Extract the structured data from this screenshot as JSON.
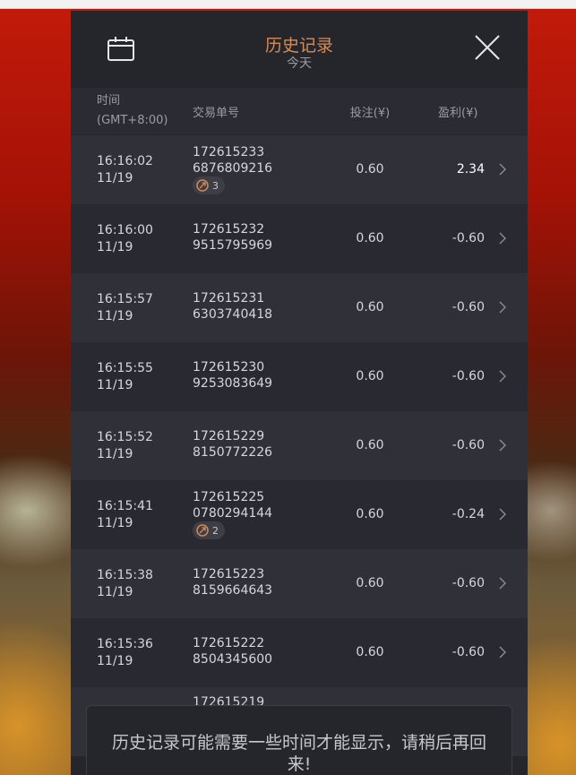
{
  "header": {
    "title": "历史记录",
    "subtitle": "今天"
  },
  "columns": {
    "time_line1": "时间",
    "time_line2": "(GMT+8:00)",
    "order": "交易单号",
    "bet": "投注(¥)",
    "profit": "盈利(¥)"
  },
  "rows": [
    {
      "time": "16:16:02",
      "date": "11/19",
      "order1": "172615233",
      "order2": "6876809216",
      "bet": "0.60",
      "profit": "2.34",
      "badge": "3"
    },
    {
      "time": "16:16:00",
      "date": "11/19",
      "order1": "172615232",
      "order2": "9515795969",
      "bet": "0.60",
      "profit": "-0.60"
    },
    {
      "time": "16:15:57",
      "date": "11/19",
      "order1": "172615231",
      "order2": "6303740418",
      "bet": "0.60",
      "profit": "-0.60"
    },
    {
      "time": "16:15:55",
      "date": "11/19",
      "order1": "172615230",
      "order2": "9253083649",
      "bet": "0.60",
      "profit": "-0.60"
    },
    {
      "time": "16:15:52",
      "date": "11/19",
      "order1": "172615229",
      "order2": "8150772226",
      "bet": "0.60",
      "profit": "-0.60"
    },
    {
      "time": "16:15:41",
      "date": "11/19",
      "order1": "172615225",
      "order2": "0780294144",
      "bet": "0.60",
      "profit": "-0.24",
      "badge": "2"
    },
    {
      "time": "16:15:38",
      "date": "11/19",
      "order1": "172615223",
      "order2": "8159664643",
      "bet": "0.60",
      "profit": "-0.60"
    },
    {
      "time": "16:15:36",
      "date": "11/19",
      "order1": "172615222",
      "order2": "8504345600",
      "bet": "0.60",
      "profit": "-0.60"
    },
    {
      "order1": "172615219"
    }
  ],
  "toast": {
    "message": "历史记录可能需要一些时间才能显示，请稍后再回来!"
  },
  "colors": {
    "accent": "#d78a55",
    "panel": "#25262c",
    "row_odd": "#2f3038",
    "row_even": "#292a31"
  },
  "icons": [
    "calendar-icon",
    "close-icon",
    "chevron-right-icon",
    "free-spin-icon"
  ]
}
